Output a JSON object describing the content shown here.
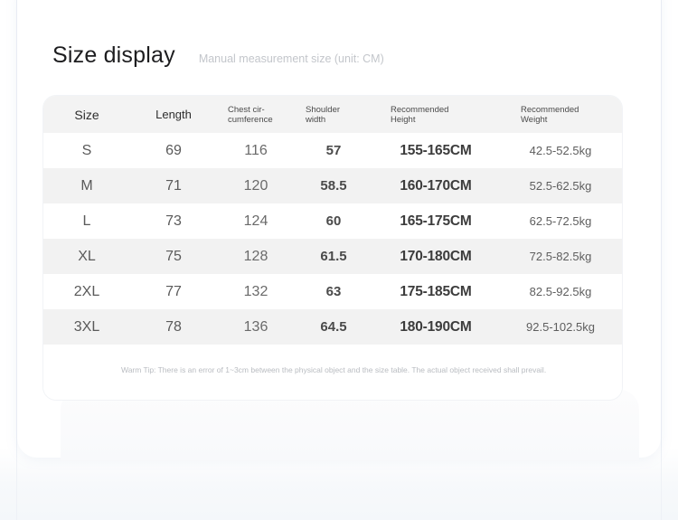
{
  "heading": {
    "title": "Size display",
    "subtitle": "Manual measurement size (unit: CM)"
  },
  "table": {
    "columns": [
      {
        "key": "size",
        "label": "Size"
      },
      {
        "key": "length",
        "label": "Length"
      },
      {
        "key": "chest",
        "label": "Chest cir-\ncumference"
      },
      {
        "key": "shoulder",
        "label": "Shoulder\nwidth"
      },
      {
        "key": "height",
        "label": "Recommended\nHeight"
      },
      {
        "key": "weight",
        "label": "Recommended\nWeight"
      }
    ],
    "header": {
      "size": "Size",
      "length": "Length",
      "chest_line1": "Chest cir-",
      "chest_line2": "cumference",
      "shoulder_line1": "Shoulder",
      "shoulder_line2": "width",
      "height_line1": "Recommended",
      "height_line2": "Height",
      "weight_line1": "Recommended",
      "weight_line2": "Weight"
    },
    "rows": [
      {
        "size": "S",
        "length": "69",
        "chest": "116",
        "shoulder": "57",
        "height": "155-165CM",
        "weight": "42.5-52.5kg"
      },
      {
        "size": "M",
        "length": "71",
        "chest": "120",
        "shoulder": "58.5",
        "height": "160-170CM",
        "weight": "52.5-62.5kg"
      },
      {
        "size": "L",
        "length": "73",
        "chest": "124",
        "shoulder": "60",
        "height": "165-175CM",
        "weight": "62.5-72.5kg"
      },
      {
        "size": "XL",
        "length": "75",
        "chest": "128",
        "shoulder": "61.5",
        "height": "170-180CM",
        "weight": "72.5-82.5kg"
      },
      {
        "size": "2XL",
        "length": "77",
        "chest": "132",
        "shoulder": "63",
        "height": "175-185CM",
        "weight": "82.5-92.5kg"
      },
      {
        "size": "3XL",
        "length": "78",
        "chest": "136",
        "shoulder": "64.5",
        "height": "180-190CM",
        "weight": "92.5-102.5kg"
      }
    ],
    "footer_note": "Warm Tip: There is an error of 1~3cm between the physical object and the size table. The actual object received shall prevail."
  },
  "colors": {
    "page_background": "#ffffff",
    "card_background": "#ffffff",
    "header_row": "#f3f3f3",
    "stripe_row": "#f2f2f2",
    "title_text": "#1d1d1f",
    "subtitle_text": "#c3c6cb",
    "note_text": "#b9bcc1",
    "edge_rule": "#eef1f6"
  }
}
